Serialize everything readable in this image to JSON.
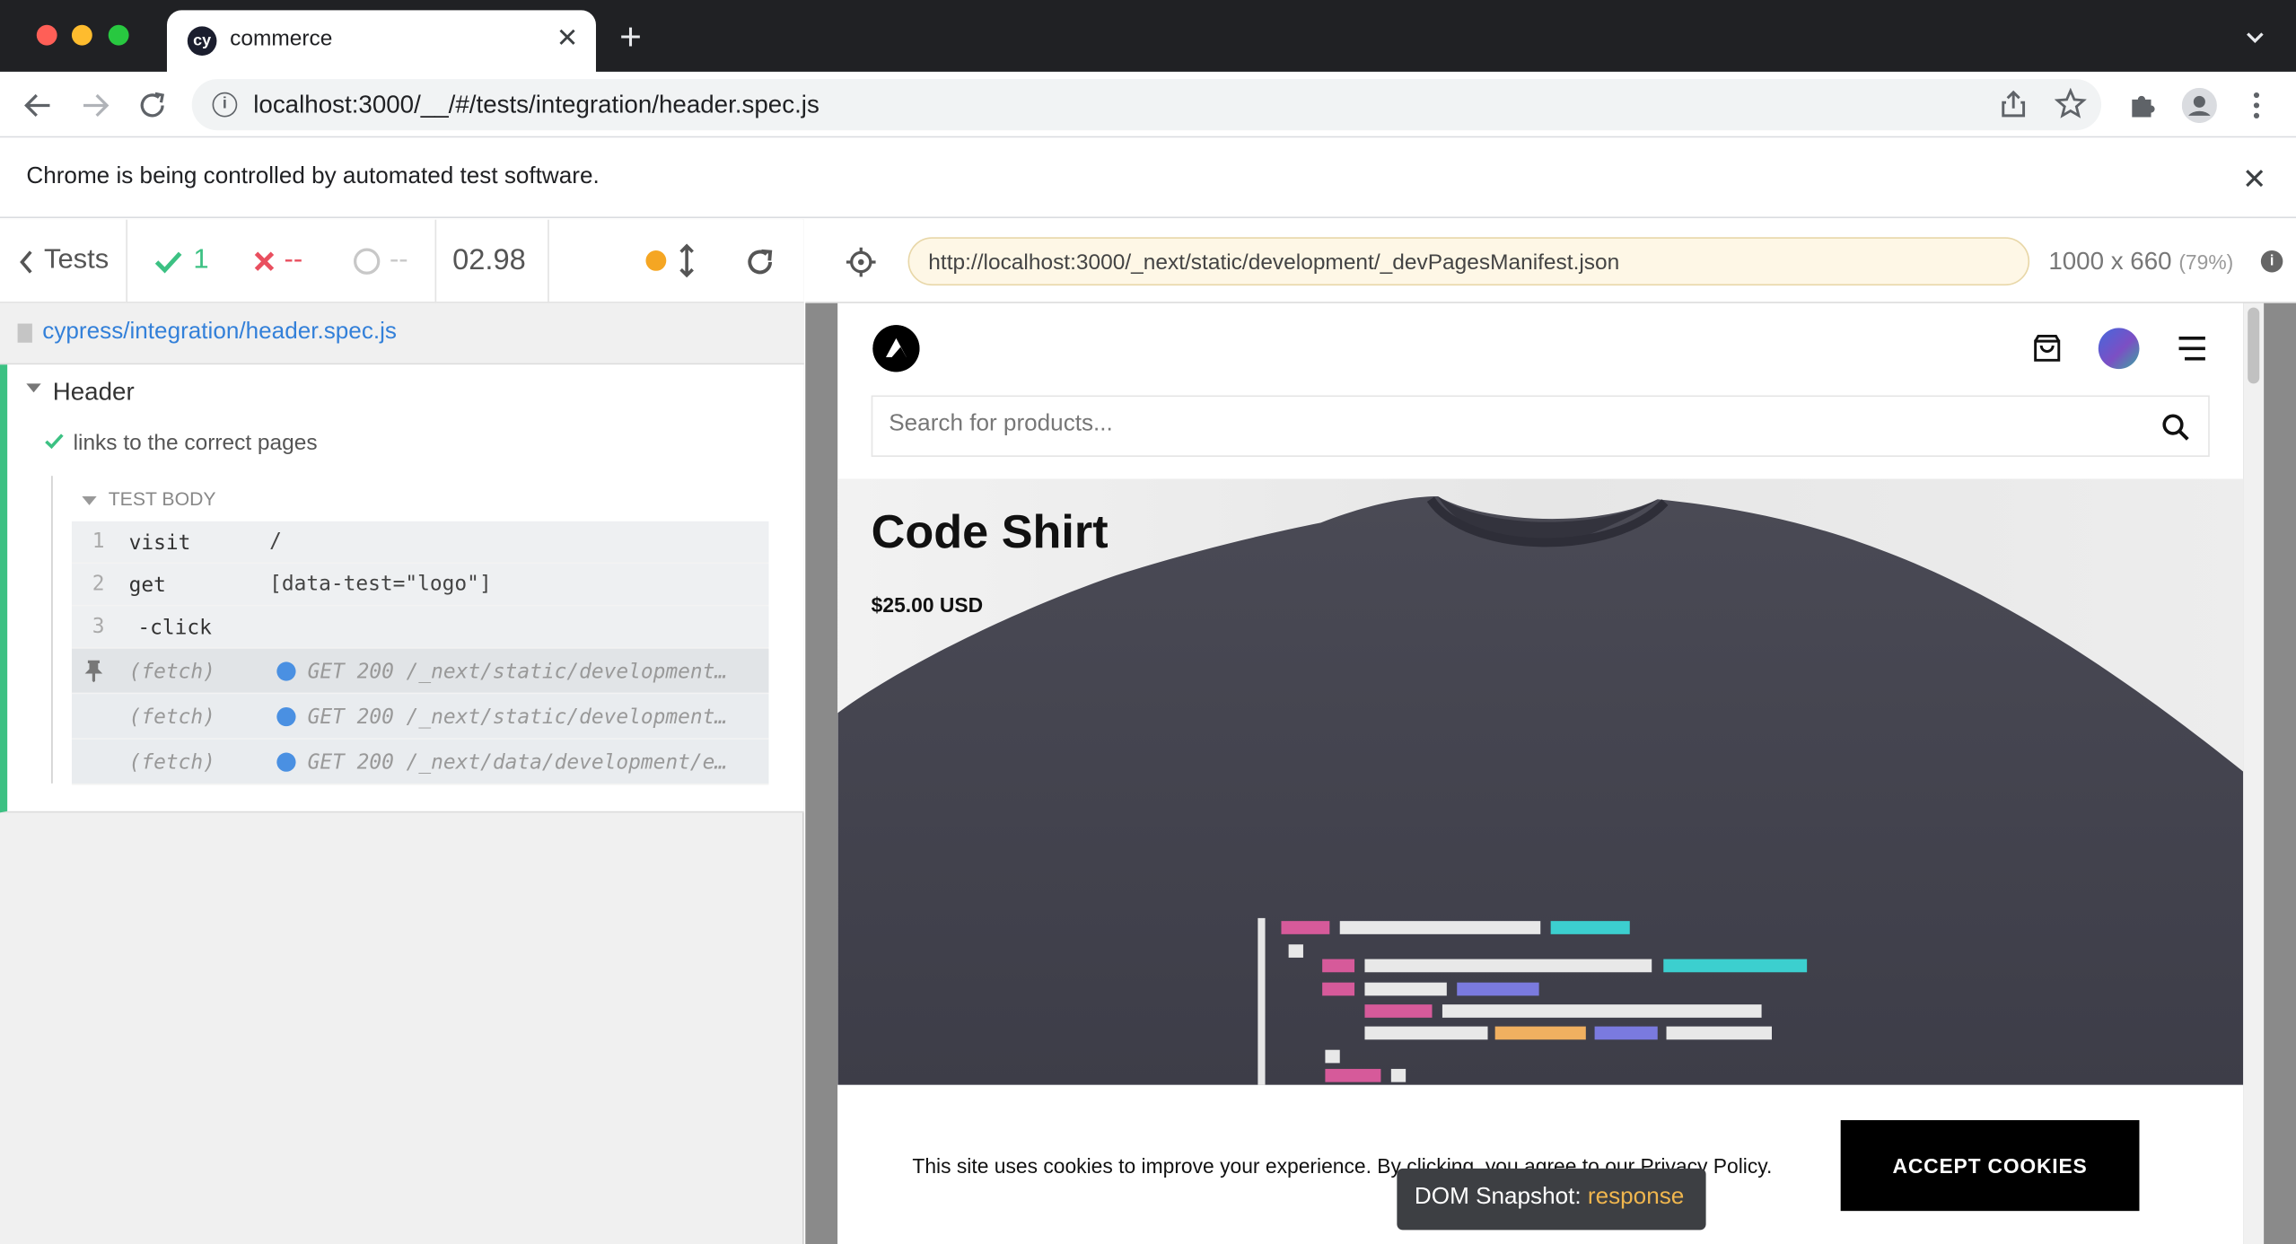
{
  "browser": {
    "tab_title": "commerce",
    "tab_favicon": "cy",
    "url": "localhost:3000/__/#/tests/integration/header.spec.js",
    "infobar_message": "Chrome is being controlled by automated test software."
  },
  "reporter": {
    "tests_label": "Tests",
    "passed_count": "1",
    "failed_count": "--",
    "pending_count": "--",
    "duration": "02.98",
    "spec_path": "cypress/integration/header.spec.js",
    "suite_title": "Header",
    "test_title": "links to the correct pages",
    "test_body_label": "TEST BODY",
    "commands": [
      {
        "number": "1",
        "name": "visit",
        "message": "/"
      },
      {
        "number": "2",
        "name": "get",
        "message": "[data-test=\"logo\"]"
      },
      {
        "number": "3",
        "name": "-click",
        "message": ""
      }
    ],
    "network_requests": [
      {
        "name": "(fetch)",
        "message": "GET 200 /_next/static/development…",
        "pinned": true
      },
      {
        "name": "(fetch)",
        "message": "GET 200 /_next/static/development…",
        "pinned": false
      },
      {
        "name": "(fetch)",
        "message": "GET 200 /_next/data/development/e…",
        "pinned": false
      }
    ],
    "colors": {
      "passed": "#3cc183",
      "failed": "#e94f5f",
      "running": "#f5a623",
      "request_dot": "#4a90e2"
    }
  },
  "aut": {
    "url": "http://localhost:3000/_next/static/development/_devPagesManifest.json",
    "viewport_size": "1000 x 660",
    "viewport_scale": "(79%)",
    "search_placeholder": "Search for products...",
    "product_name": "Code Shirt",
    "product_price": "$25.00 USD",
    "cookie_message": "This site uses cookies to improve your experience. By clicking, you agree to our Privacy Policy.",
    "cookie_button": "ACCEPT COOKIES",
    "snapshot_label": "DOM Snapshot:",
    "snapshot_state": "response"
  }
}
